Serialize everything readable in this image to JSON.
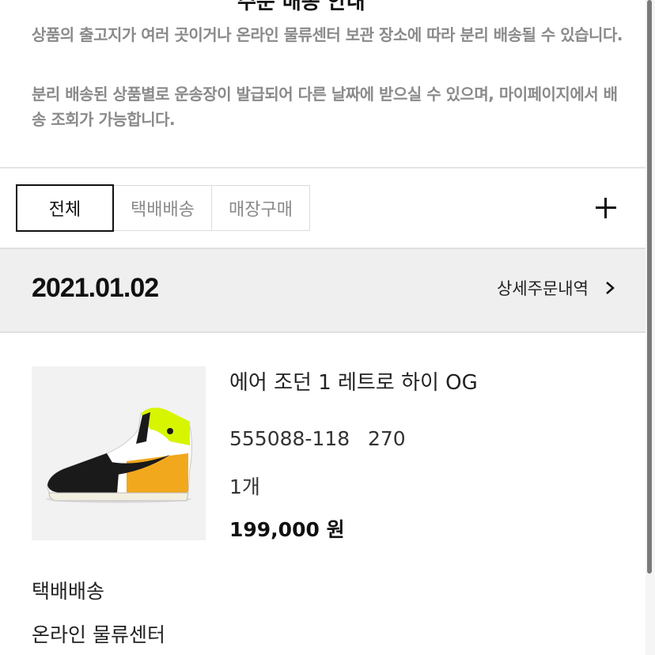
{
  "notice": {
    "title": "주문 배송 안내",
    "paragraph1": "상품의 출고지가 여러 곳이거나 온라인 물류센터 보관 장소에 따라 분리 배송될 수 있습니다.",
    "paragraph2": "분리 배송된 상품별로 운송장이 발급되어 다른 날짜에 받으실 수 있으며, 마이페이지에서 배송 조회가 가능합니다."
  },
  "tabs": [
    {
      "label": "전체",
      "selected": true
    },
    {
      "label": "택배배송",
      "selected": false
    },
    {
      "label": "매장구매",
      "selected": false
    }
  ],
  "add_button_icon": "plus-icon",
  "order": {
    "date": "2021.01.02",
    "detail_link": "상세주문내역",
    "detail_icon": "chevron-right-icon"
  },
  "product": {
    "name": "에어 조던 1 레트로 하이 OG",
    "code": "555088-118",
    "size": "270",
    "quantity": "1개",
    "price": "199,000 원",
    "image_icon": "sneaker-image"
  },
  "shipping": {
    "method": "택배배송",
    "origin": "온라인 물류센터"
  },
  "colors": {
    "text_muted": "#8a8a8a",
    "date_bar_bg": "#efefef",
    "sneaker_yellow": "#f2a81d",
    "sneaker_volt": "#d8f500"
  }
}
